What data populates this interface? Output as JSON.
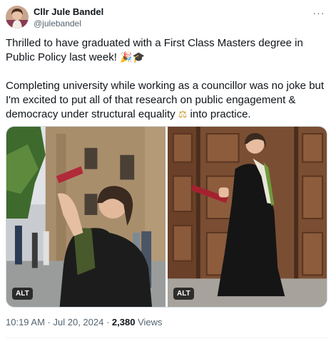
{
  "author": {
    "display_name": "Cllr Jule Bandel",
    "handle": "@julebandel",
    "avatar_icon": "profile-photo"
  },
  "more_icon": "ellipsis-icon",
  "more_label": "···",
  "tweet": {
    "paragraph1": "Thrilled to have graduated with a First Class Masters degree in Public Policy last week!",
    "paragraph1_emoji": "🎉🎓",
    "paragraph2_a": "Completing university while working as a councillor was no joke but I'm excited to put all of that research on public engagement & democracy under structural equality",
    "paragraph2_emoji": "⚖",
    "paragraph2_b": "into practice."
  },
  "media": [
    {
      "alt_label": "ALT"
    },
    {
      "alt_label": "ALT"
    }
  ],
  "meta": {
    "time": "10:19 AM",
    "sep1": " · ",
    "date": "Jul 20, 2024",
    "sep2": " · ",
    "views": "2,380",
    "views_label": " Views"
  },
  "colors": {
    "text": "#0f1419",
    "secondary": "#536471",
    "border": "#cfd9de"
  }
}
